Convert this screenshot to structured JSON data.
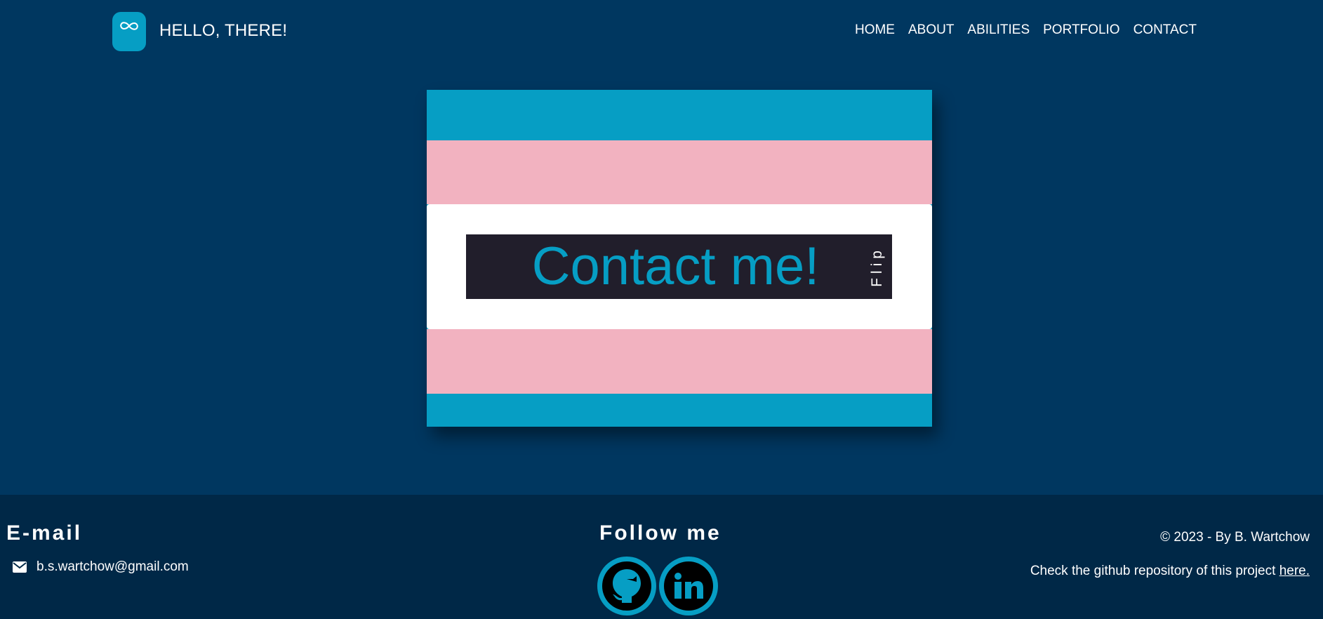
{
  "header": {
    "brand": "HELLO, THERE!",
    "logo_icon": "infinity-icon",
    "nav": [
      {
        "label": "HOME"
      },
      {
        "label": "ABOUT"
      },
      {
        "label": "ABILITIES"
      },
      {
        "label": "PORTFOLIO"
      },
      {
        "label": "CONTACT"
      }
    ]
  },
  "card": {
    "title": "Contact me!",
    "flip_label": "Flip"
  },
  "footer": {
    "email_title": "E-mail",
    "email_icon": "envelope-icon",
    "email": "b.s.wartchow@gmail.com",
    "follow_title": "Follow me",
    "social": [
      {
        "icon": "github-icon"
      },
      {
        "icon": "linkedin-icon"
      }
    ],
    "copyright": "© 2023 - By B. Wartchow",
    "repo_text": "Check the github repository of this project ",
    "repo_link": "here."
  },
  "colors": {
    "background": "#003760",
    "footer": "#002847",
    "accent": "#069ec4",
    "pink": "#f2b2c0",
    "dark_box": "#211e2b"
  }
}
